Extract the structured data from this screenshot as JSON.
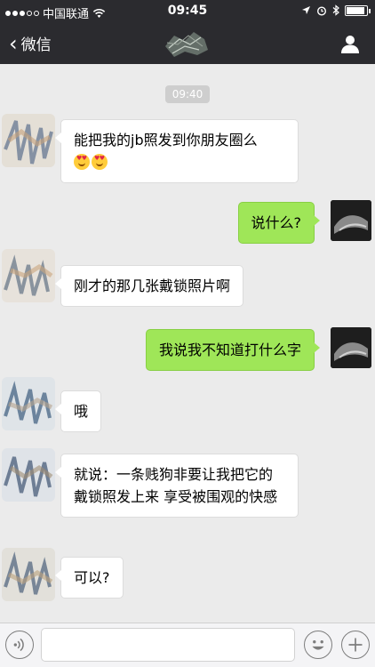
{
  "status_bar": {
    "carrier": "中国联通",
    "time": "09:45",
    "battery_level": 0.9
  },
  "nav": {
    "back_label": "微信"
  },
  "chat": {
    "timestamp": "09:40",
    "messages": [
      {
        "side": "in",
        "text": "能把我的jb照发到你朋友圈么",
        "emojis": 2
      },
      {
        "side": "out",
        "text": "说什么?"
      },
      {
        "side": "in",
        "text": "刚才的那几张戴锁照片啊"
      },
      {
        "side": "out",
        "text": "我说我不知道打什么字"
      },
      {
        "side": "in",
        "text": "哦"
      },
      {
        "side": "in",
        "text": "就说：一条贱狗非要让我把它的戴锁照发上来 享受被围观的快感"
      },
      {
        "side": "in",
        "text": "可以?"
      }
    ]
  },
  "colors": {
    "nav_bg": "#2b2b2f",
    "chat_bg": "#ebebeb",
    "out_bubble": "#9fe658",
    "in_bubble": "#ffffff"
  },
  "icons": {
    "back": "chevron-left-icon",
    "profile": "person-icon",
    "voice": "voice-icon",
    "emoji": "smiley-icon",
    "plus": "plus-icon"
  }
}
